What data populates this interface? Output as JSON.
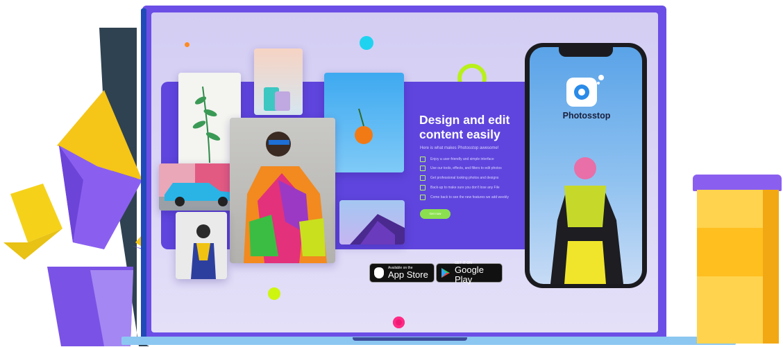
{
  "headline": "Design and edit content easily",
  "subheadline": "Here is what makes Photosstop awesome!",
  "features": [
    "Enjoy a user-friendly and simple interface",
    "Use our tools, effects, and filters to edit photos",
    "Get professional looking photos and designs",
    "Back-up to make sure you don't lose any File",
    "Come back to see the new features we add weekly"
  ],
  "cta_label": "Get now",
  "app_store": {
    "small": "Available on the",
    "big": "App Store"
  },
  "google_play": {
    "small": "GET IT ON",
    "big": "Google Play"
  },
  "phone_app_name": "Photosstop",
  "colors": {
    "banner": "#5f45dd",
    "frame": "#6b4ee6",
    "accent_green": "#8be04f",
    "cup": "#ffd34d",
    "plant": "#8a5ff0"
  }
}
